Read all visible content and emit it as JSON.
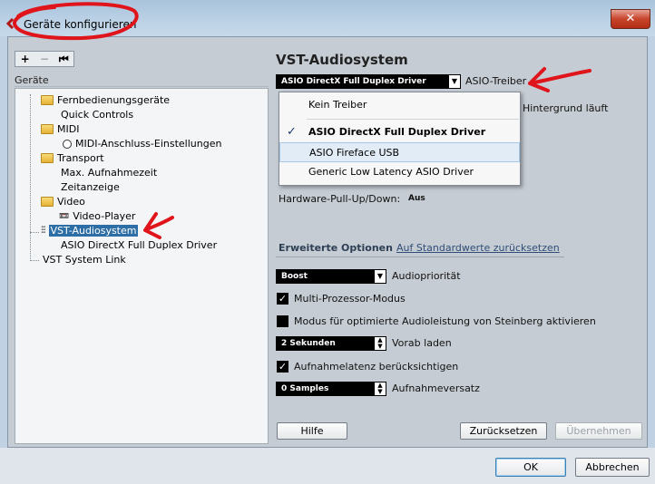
{
  "window": {
    "title": "Geräte konfigurieren",
    "close_label": "✕"
  },
  "left_panel": {
    "toolbar": {
      "add": "+",
      "remove": "−",
      "reset": "⏮"
    },
    "header": "Geräte",
    "tree": {
      "fernbedienung": "Fernbedienungsgeräte",
      "quick_controls": "Quick Controls",
      "midi": "MIDI",
      "midi_anschluss": "MIDI-Anschluss-Einstellungen",
      "transport": "Transport",
      "max_aufnahme": "Max. Aufnahmezeit",
      "zeitanzeige": "Zeitanzeige",
      "video": "Video",
      "video_player": "Video-Player",
      "vst_audio": "VST-Audiosystem",
      "asio_driver": "ASIO DirectX Full Duplex Driver",
      "vst_link": "VST System Link"
    }
  },
  "right_panel": {
    "title": "VST-Audiosystem",
    "driver_select": {
      "value": "ASIO DirectX Full Duplex Driver",
      "label": "ASIO-Treiber",
      "options": [
        "Kein Treiber",
        "ASIO DirectX Full Duplex Driver",
        "ASIO Fireface USB",
        "Generic Low Latency ASIO Driver"
      ],
      "checked_index": 1,
      "hover_index": 2
    },
    "background_text": "Hintergrund läuft",
    "hw_pull_label": "Hardware-Pull-Up/Down:",
    "hw_pull_value": "Aus",
    "tabs": {
      "active": "Erweiterte Optionen",
      "link": "Auf Standardwerte zurücksetzen"
    },
    "audio_priority": {
      "value": "Boost",
      "label": "Audiopriorität"
    },
    "multiprozessor": {
      "label": "Multi-Prozessor-Modus",
      "checked": true
    },
    "steinberg_mode": {
      "label": "Modus für optimierte Audioleistung von Steinberg aktivieren",
      "checked": false
    },
    "vorab": {
      "value": "2 Sekunden",
      "label": "Vorab laden"
    },
    "latenz": {
      "label": "Aufnahmelatenz berücksichtigen",
      "checked": true
    },
    "versatz": {
      "value": "0 Samples",
      "label": "Aufnahmeversatz"
    },
    "buttons": {
      "help": "Hilfe",
      "reset": "Zurücksetzen",
      "apply": "Übernehmen"
    }
  },
  "footer": {
    "ok": "OK",
    "cancel": "Abbrechen"
  },
  "colors": {
    "selection": "#2e6ea6",
    "annotation": "#e0141b"
  }
}
